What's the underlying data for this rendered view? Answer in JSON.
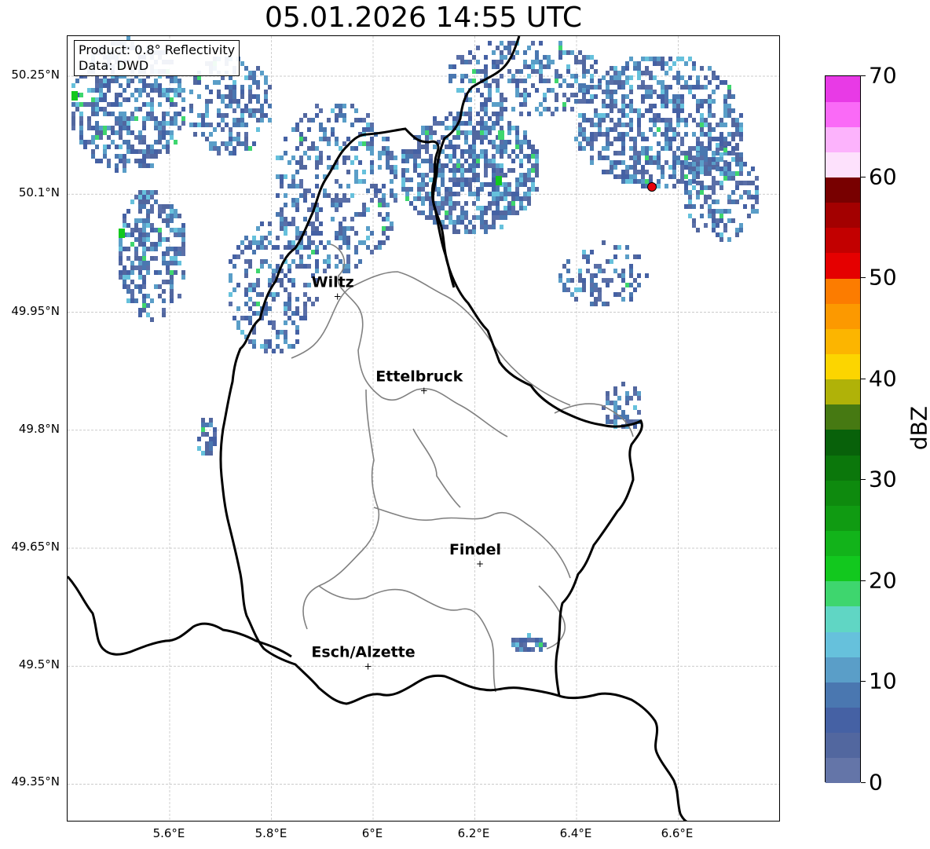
{
  "title": "05.01.2026 14:55 UTC",
  "info": {
    "line1": "Product: 0.8° Reflectivity",
    "line2": "Data: DWD"
  },
  "axes": {
    "x_ticks": [
      "5.6°E",
      "5.8°E",
      "6°E",
      "6.2°E",
      "6.4°E",
      "6.6°E"
    ],
    "y_ticks": [
      "50.25°N",
      "50.1°N",
      "49.95°N",
      "49.8°N",
      "49.65°N",
      "49.5°N",
      "49.35°N"
    ],
    "lon_range": [
      5.4,
      6.8
    ],
    "lat_range": [
      49.3,
      50.3
    ],
    "grid": true
  },
  "cities": [
    {
      "name": "Wiltz",
      "lon": 5.93,
      "lat": 49.97
    },
    {
      "name": "Ettelbruck",
      "lon": 6.1,
      "lat": 49.85
    },
    {
      "name": "Findel",
      "lon": 6.21,
      "lat": 49.63
    },
    {
      "name": "Esch/Alzette",
      "lon": 5.99,
      "lat": 49.5
    }
  ],
  "radar_site_color": "#e8000b",
  "colorbar": {
    "label": "dBZ",
    "ticks": [
      "0",
      "10",
      "20",
      "30",
      "40",
      "50",
      "60",
      "70"
    ],
    "range": [
      0,
      70
    ],
    "colors": [
      "#6475a8",
      "#52679f",
      "#4561a4",
      "#4a77b0",
      "#5a9ec8",
      "#66c1dc",
      "#60d6c4",
      "#3ed66e",
      "#12c81e",
      "#12b31a",
      "#109b12",
      "#0e8a0e",
      "#0b770b",
      "#08610a",
      "#467912",
      "#b0b208",
      "#fcd500",
      "#fcb500",
      "#fc9900",
      "#fc7c00",
      "#e50000",
      "#c20000",
      "#a30000",
      "#780000",
      "#fde1fc",
      "#fcb3fc",
      "#fa6af7",
      "#e83ae6"
    ]
  },
  "colors": {
    "border_national": "#000000",
    "border_canton": "#808080",
    "grid": "#bbbbbb"
  }
}
